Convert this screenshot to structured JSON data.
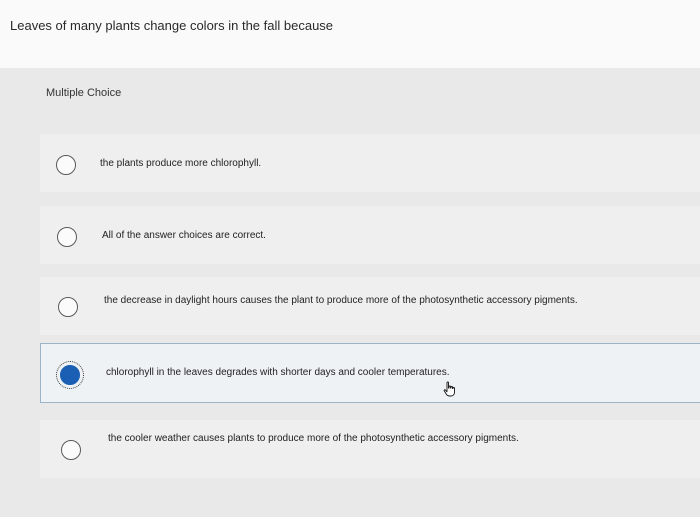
{
  "question": {
    "text": "Leaves of many plants change colors in the fall because"
  },
  "question_type": "Multiple Choice",
  "choices": [
    {
      "label": "the plants produce more chlorophyll.",
      "selected": false
    },
    {
      "label": "All of the answer choices are correct.",
      "selected": false
    },
    {
      "label": "the decrease in daylight hours causes the plant to produce more of the photosynthetic accessory pigments.",
      "selected": false
    },
    {
      "label": "chlorophyll in the leaves degrades with shorter days and cooler temperatures.",
      "selected": true
    },
    {
      "label": "the cooler weather causes plants to produce more of the photosynthetic accessory pigments.",
      "selected": false
    }
  ],
  "colors": {
    "selected_radio": "#1a5fb4",
    "selected_border": "#9bb3c7"
  },
  "icons": {
    "cursor": "hand-pointer-icon"
  }
}
